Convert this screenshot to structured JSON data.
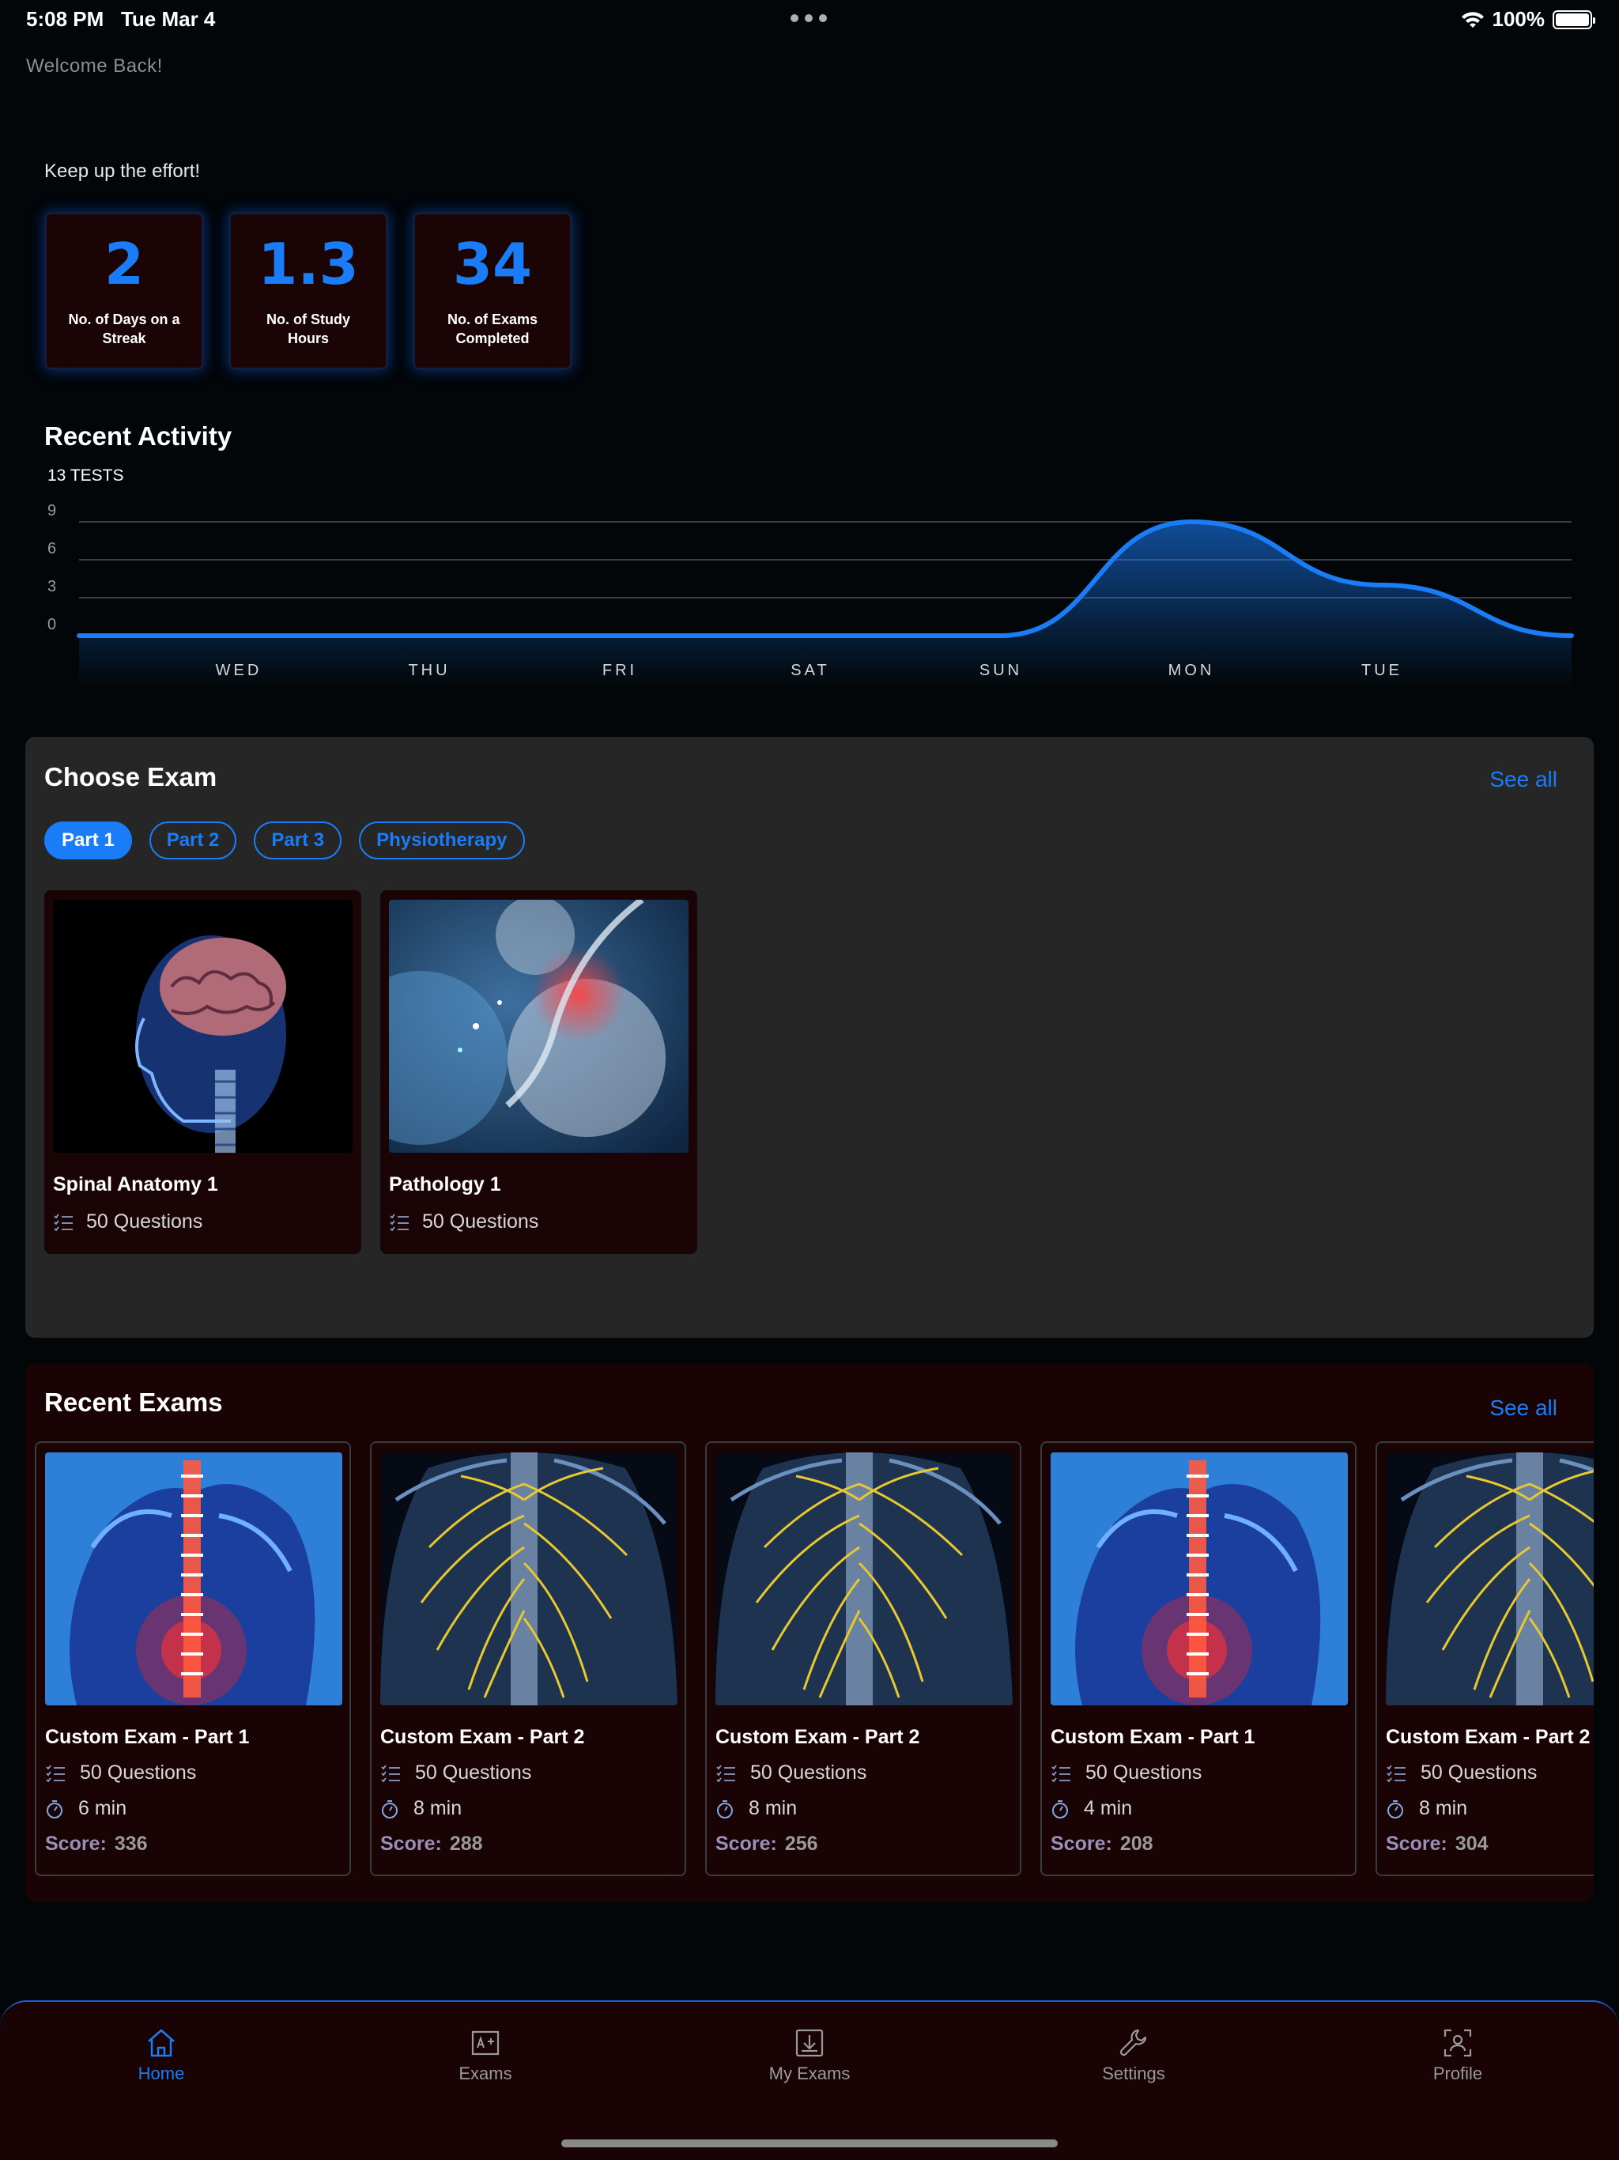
{
  "status_bar": {
    "time": "5:08 PM",
    "date": "Tue Mar 4",
    "battery": "100%"
  },
  "welcome": "Welcome Back!",
  "motivation": "Keep up the effort!",
  "stats": [
    {
      "value": "2",
      "label": "No. of Days on a Streak"
    },
    {
      "value": "1.3",
      "label": "No. of Study Hours"
    },
    {
      "value": "34",
      "label": "No. of Exams Completed"
    }
  ],
  "recent_activity": {
    "title": "Recent Activity",
    "tests": "13 TESTS"
  },
  "chart_data": {
    "type": "area",
    "categories": [
      "WED",
      "THU",
      "FRI",
      "SAT",
      "SUN",
      "MON",
      "TUE"
    ],
    "series": [
      {
        "values": [
          0,
          0,
          0,
          0,
          0,
          9,
          4
        ]
      }
    ],
    "y_ticks": [
      "0",
      "3",
      "6",
      "9"
    ],
    "ylim": [
      0,
      9
    ],
    "color": "#1a7cf6"
  },
  "choose_exam": {
    "title": "Choose Exam",
    "see_all": "See all",
    "filters": [
      "Part 1",
      "Part 2",
      "Part 3",
      "Physiotherapy"
    ],
    "active_filter": "Part 1",
    "cards": [
      {
        "name": "Spinal Anatomy 1",
        "questions": "50 Questions",
        "image": "brain-head-xray"
      },
      {
        "name": "Pathology 1",
        "questions": "50 Questions",
        "image": "cells-molecular"
      }
    ]
  },
  "recent_exams": {
    "title": "Recent Exams",
    "see_all": "See all",
    "cards": [
      {
        "name": "Custom Exam - Part 1",
        "questions": "50 Questions",
        "duration": "6 min",
        "score_label": "Score:",
        "score": "336",
        "image": "spine-pain"
      },
      {
        "name": "Custom Exam - Part 2",
        "questions": "50 Questions",
        "duration": "8 min",
        "score_label": "Score:",
        "score": "288",
        "image": "nerves-back"
      },
      {
        "name": "Custom Exam - Part 2",
        "questions": "50 Questions",
        "duration": "8 min",
        "score_label": "Score:",
        "score": "256",
        "image": "nerves-back"
      },
      {
        "name": "Custom Exam - Part 1",
        "questions": "50 Questions",
        "duration": "4 min",
        "score_label": "Score:",
        "score": "208",
        "image": "spine-pain"
      },
      {
        "name": "Custom Exam - Part 2",
        "questions": "50 Questions",
        "duration": "8 min",
        "score_label": "Score:",
        "score": "304",
        "image": "nerves-back"
      }
    ]
  },
  "tabs": [
    {
      "label": "Home",
      "icon": "home-icon",
      "active": true
    },
    {
      "label": "Exams",
      "icon": "exams-icon",
      "active": false
    },
    {
      "label": "My Exams",
      "icon": "download-icon",
      "active": false
    },
    {
      "label": "Settings",
      "icon": "wrench-icon",
      "active": false
    },
    {
      "label": "Profile",
      "icon": "profile-icon",
      "active": false
    }
  ]
}
